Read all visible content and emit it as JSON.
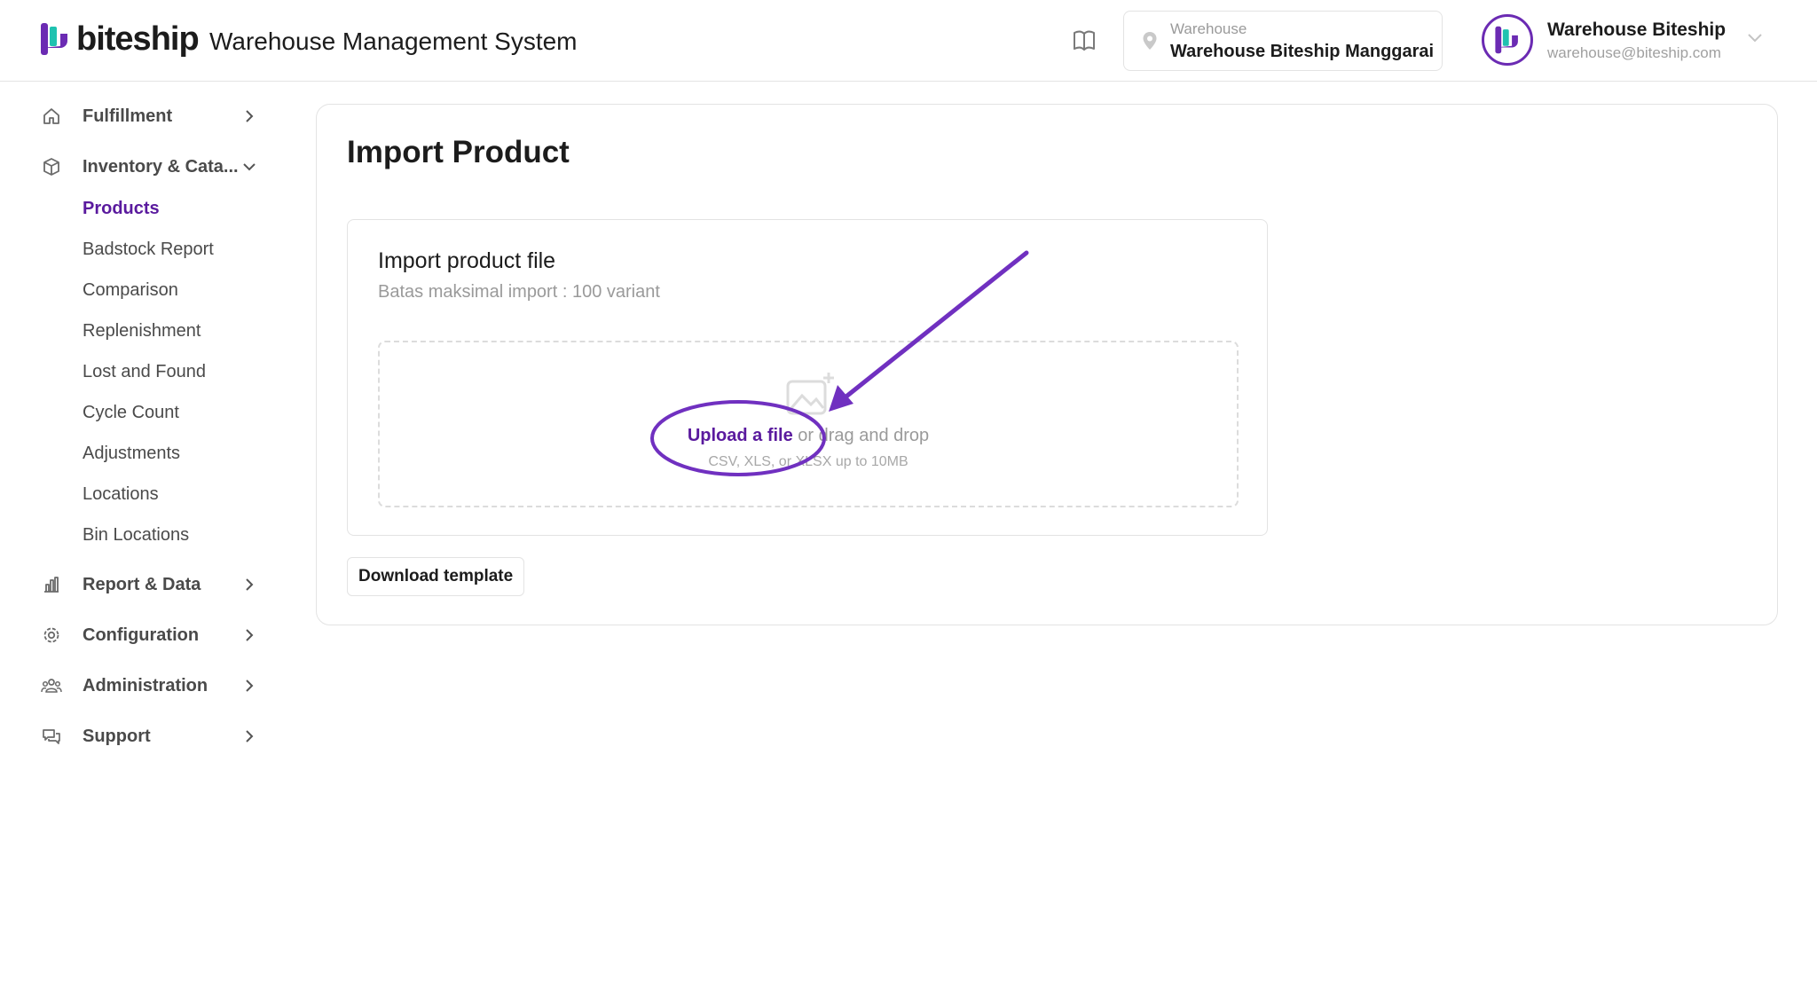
{
  "header": {
    "brand": "biteship",
    "app_title": "Warehouse Management System",
    "warehouse": {
      "label": "Warehouse",
      "value": "Warehouse Biteship Manggarai"
    },
    "user": {
      "name": "Warehouse Biteship",
      "email": "warehouse@biteship.com"
    },
    "icons": {
      "docs": "book-icon",
      "location": "pin-icon",
      "user_menu": "chevron-down-icon"
    }
  },
  "sidebar": {
    "groups": [
      {
        "label": "Fulfillment",
        "icon": "home-icon",
        "expanded": false
      },
      {
        "label": "Inventory & Cata...",
        "icon": "box-icon",
        "expanded": true
      },
      {
        "label": "Report & Data",
        "icon": "bar-chart-icon",
        "expanded": false
      },
      {
        "label": "Configuration",
        "icon": "gear-icon",
        "expanded": false
      },
      {
        "label": "Administration",
        "icon": "users-icon",
        "expanded": false
      },
      {
        "label": "Support",
        "icon": "chat-icon",
        "expanded": false
      }
    ],
    "inventory_items": [
      "Products",
      "Badstock Report",
      "Comparison",
      "Replenishment",
      "Lost and Found",
      "Cycle Count",
      "Adjustments",
      "Locations",
      "Bin Locations"
    ],
    "active_item": "Products"
  },
  "main": {
    "title": "Import Product",
    "import": {
      "title": "Import product file",
      "subtitle": "Batas maksimal import : 100 variant",
      "upload_link": "Upload a file",
      "drag_text": " or drag and drop",
      "hint": "CSV, XLS, or XLSX up to 10MB",
      "icon": "image-add-icon"
    },
    "download_label": "Download template"
  },
  "colors": {
    "brand": "#6b2bb3",
    "active_nav": "#5a1a9e",
    "annotation": "#7030c0",
    "accent_teal": "#1fc2b0"
  }
}
